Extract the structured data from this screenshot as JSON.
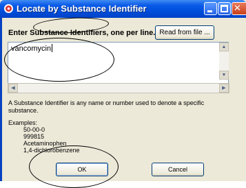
{
  "window": {
    "title": "Locate by Substance Identifier"
  },
  "colors": {
    "titlebar": "#0050dd",
    "face": "#ece9d8",
    "button_border": "#003c74",
    "close_button": "#c8401c"
  },
  "icons": {
    "app": "app-icon",
    "minimize": "minimize-icon",
    "maximize": "maximize-icon",
    "close": "close-icon"
  },
  "form": {
    "prompt": "Enter Substance Identifiers, one per line.",
    "read_file_label": "Read from file ...",
    "identifiers_value": "vancomycin"
  },
  "help": {
    "description": "A Substance Identifier is any name or number used to denote a specific substance.",
    "examples_label": "Examples:",
    "examples": [
      "50-00-0",
      "999815",
      "Acetaminophen",
      "1,4-dichlorobenzene"
    ]
  },
  "buttons": {
    "ok": "OK",
    "cancel": "Cancel"
  }
}
